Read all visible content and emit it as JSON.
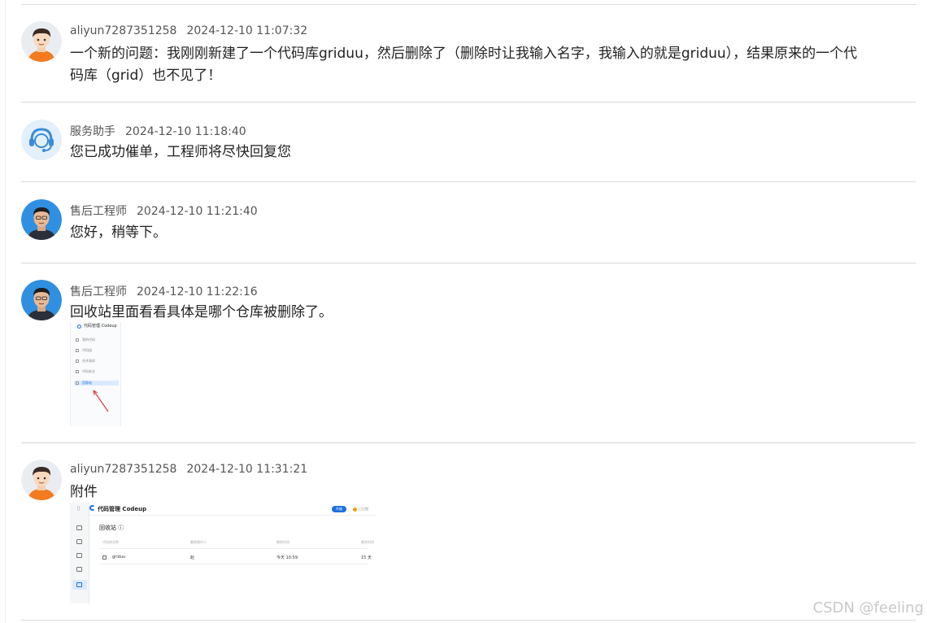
{
  "messages": [
    {
      "author": "aliyun7287351258",
      "time": "2024-12-10 11:07:32",
      "avatar": "user-avatar-icon",
      "lines": [
        "一个新的问题：我刚刚新建了一个代码库griduu，然后删除了（删除时让我输入名字，我输入的就是griduu），结果原来的一个代",
        "码库（grid）也不见了！"
      ]
    },
    {
      "author": "服务助手",
      "time": "2024-12-10 11:18:40",
      "avatar": "service-bot-avatar-icon",
      "lines": [
        "您已成功催单，工程师将尽快回复您"
      ]
    },
    {
      "author": "售后工程师",
      "time": "2024-12-10 11:21:40",
      "avatar": "engineer-avatar-icon",
      "lines": [
        "您好，稍等下。"
      ]
    },
    {
      "author": "售后工程师",
      "time": "2024-12-10 11:22:16",
      "avatar": "engineer-avatar-icon",
      "lines": [
        "回收站里面看看具体是哪个仓库被删除了。"
      ]
    },
    {
      "author": "aliyun7287351258",
      "time": "2024-12-10 11:31:21",
      "avatar": "user-avatar-icon",
      "lines": [
        "附件"
      ]
    }
  ],
  "screenshot1": {
    "title": "代码管理 Codeup",
    "items": [
      "我的代码",
      "代码组",
      "合并请求",
      "代码安全",
      "回收站"
    ],
    "active_index": 4,
    "mark": "⏸"
  },
  "screenshot2": {
    "app_title": "代码管理 Codeup",
    "pill": "升级",
    "tail": "已过期",
    "page_title": "回收站 ⓘ",
    "headers": [
      "代码库名称",
      "删除操作人",
      "删除时间",
      "剩余时间"
    ],
    "row": [
      "griduu",
      "赵",
      "今天 10:59",
      "15 天"
    ]
  },
  "watermark": "CSDN @feeling",
  "colors": {
    "accent": "#1e6fe0",
    "divider": "#d9d9d9",
    "user_orange": "#f27c1f"
  }
}
